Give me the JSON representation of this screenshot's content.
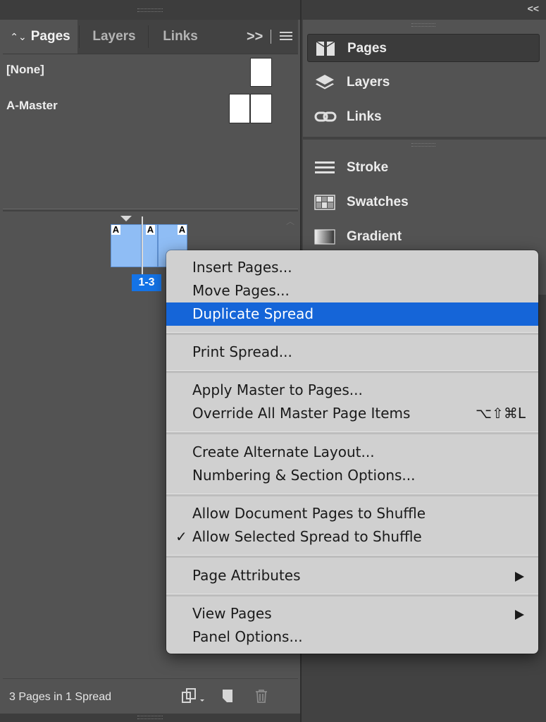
{
  "pages_panel": {
    "tabs": [
      {
        "label": "Pages",
        "active": true
      },
      {
        "label": "Layers",
        "active": false
      },
      {
        "label": "Links",
        "active": false
      }
    ],
    "collapse_glyph": ">>",
    "masters": [
      {
        "label": "[None]"
      },
      {
        "label": "A-Master"
      }
    ],
    "spread": {
      "page_prefix_labels": [
        "A",
        "A",
        "A"
      ],
      "number_label": "1-3"
    },
    "status_text": "3 Pages in 1 Spread"
  },
  "dock": {
    "collapse_glyph": "<<",
    "items": [
      {
        "label": "Pages",
        "icon": "pages-icon",
        "active": true
      },
      {
        "label": "Layers",
        "icon": "layers-icon",
        "active": false
      },
      {
        "label": "Links",
        "icon": "links-icon",
        "active": false
      },
      {
        "label": "Stroke",
        "icon": "stroke-icon",
        "active": false
      },
      {
        "label": "Swatches",
        "icon": "swatches-icon",
        "active": false
      },
      {
        "label": "Gradient",
        "icon": "gradient-icon",
        "active": false
      }
    ]
  },
  "context_menu": {
    "items": [
      {
        "label": "Insert Pages..."
      },
      {
        "label": "Move Pages..."
      },
      {
        "label": "Duplicate Spread",
        "highlighted": true
      },
      {
        "label": "Print Spread..."
      },
      {
        "label": "Apply Master to Pages..."
      },
      {
        "label": "Override All Master Page Items",
        "shortcut": "⌥⇧⌘L"
      },
      {
        "label": "Create Alternate Layout..."
      },
      {
        "label": "Numbering & Section Options..."
      },
      {
        "label": "Allow Document Pages to Shuffle"
      },
      {
        "label": "Allow Selected Spread to Shuffle",
        "checked": true,
        "check_glyph": "✓"
      },
      {
        "label": "Page Attributes",
        "submenu": true
      },
      {
        "label": "View Pages",
        "submenu": true
      },
      {
        "label": "Panel Options..."
      }
    ]
  },
  "colors": {
    "panel_bg": "#535353",
    "selection_blue": "#1473e6",
    "menu_highlight": "#1565d8",
    "page_thumb_blue": "#8fbdf5"
  }
}
